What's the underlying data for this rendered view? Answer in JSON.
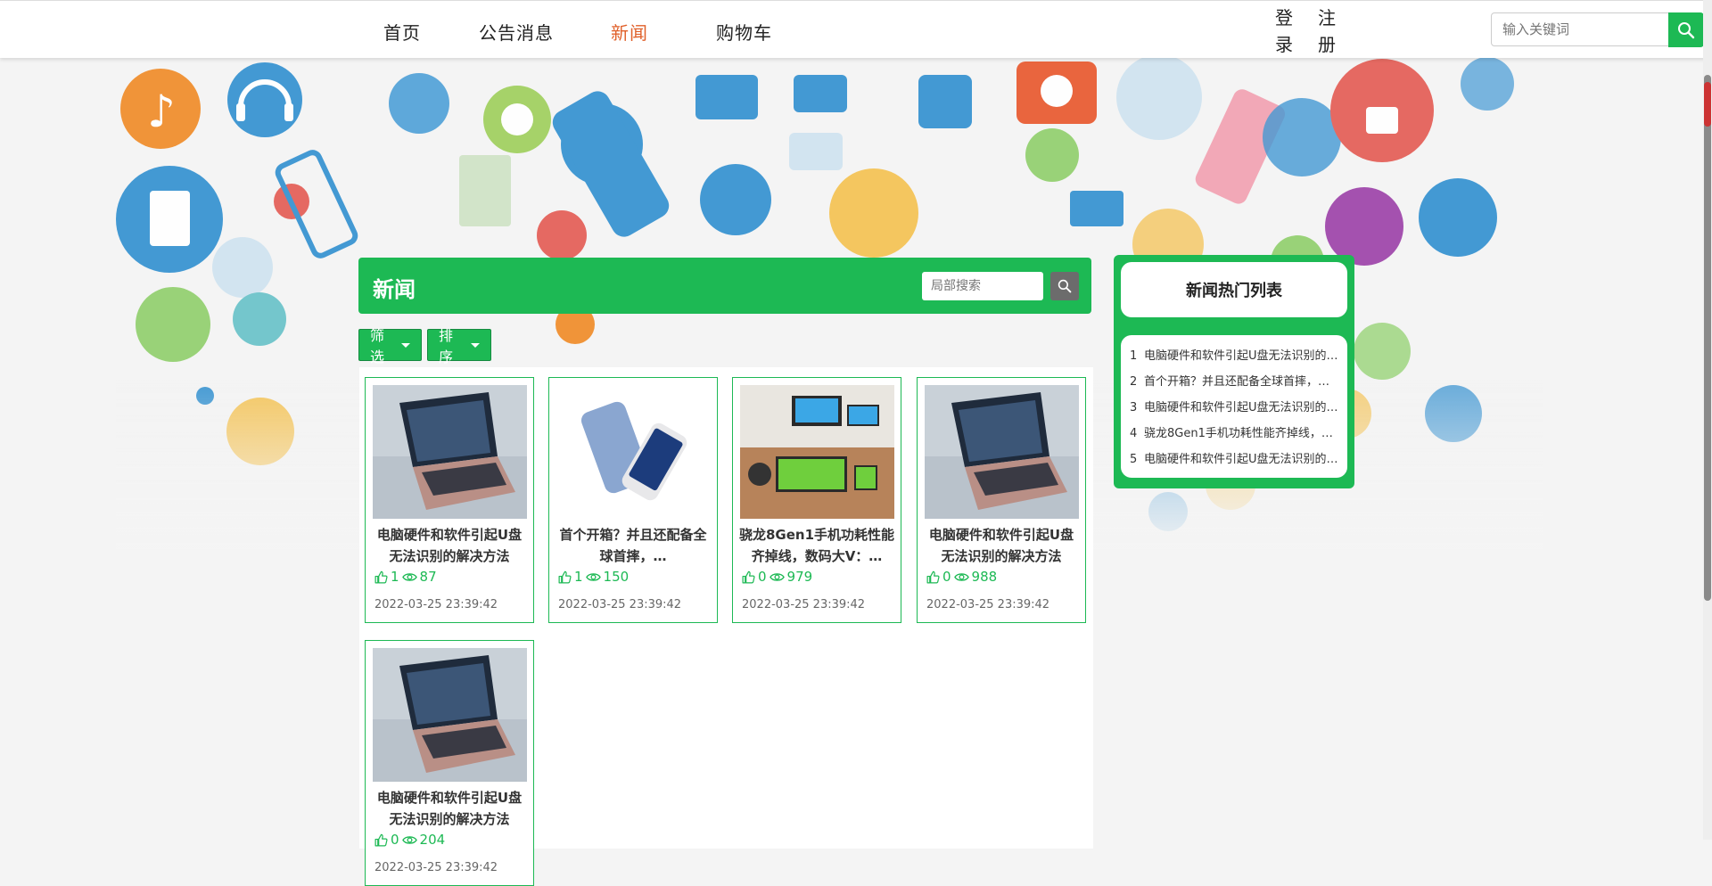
{
  "nav": {
    "items": [
      {
        "label": "首页",
        "active": false
      },
      {
        "label": "公告消息",
        "active": false
      },
      {
        "label": "新闻",
        "active": true
      },
      {
        "label": "购物车",
        "active": false
      }
    ],
    "login": "登录",
    "register": "注册",
    "search_placeholder": "输入关键词"
  },
  "news": {
    "title": "新闻",
    "search_placeholder": "局部搜索",
    "filter_label": "筛选",
    "sort_label": "排序",
    "cards": [
      {
        "title": "电脑硬件和软件引起U盘无法识别的解决方法",
        "likes": "1",
        "views": "87",
        "date": "2022-03-25 23:39:42",
        "image": "laptop"
      },
      {
        "title": "首个开箱？并且还配备全球首摔，…",
        "likes": "1",
        "views": "150",
        "date": "2022-03-25 23:39:42",
        "image": "phones"
      },
      {
        "title": "骁龙8Gen1手机功耗性能齐掉线，数码大V：…",
        "likes": "0",
        "views": "979",
        "date": "2022-03-25 23:39:42",
        "image": "devices"
      },
      {
        "title": "电脑硬件和软件引起U盘无法识别的解决方法",
        "likes": "0",
        "views": "988",
        "date": "2022-03-25 23:39:42",
        "image": "laptop"
      },
      {
        "title": "电脑硬件和软件引起U盘无法识别的解决方法",
        "likes": "0",
        "views": "204",
        "date": "2022-03-25 23:39:42",
        "image": "laptop"
      }
    ]
  },
  "hot": {
    "title": "新闻热门列表",
    "items": [
      {
        "num": "1",
        "text": "电脑硬件和软件引起U盘无法识别的解决方法"
      },
      {
        "num": "2",
        "text": "首个开箱？并且还配备全球首摔，…"
      },
      {
        "num": "3",
        "text": "电脑硬件和软件引起U盘无法识别的解决方法"
      },
      {
        "num": "4",
        "text": "骁龙8Gen1手机功耗性能齐掉线，数码大V：…"
      },
      {
        "num": "5",
        "text": "电脑硬件和软件引起U盘无法识别的解决方法"
      }
    ]
  },
  "colors": {
    "accent": "#1db954",
    "active_nav": "#e0602a"
  },
  "icons": [
    "search-icon",
    "like-icon",
    "eye-icon",
    "caret-down-icon"
  ]
}
